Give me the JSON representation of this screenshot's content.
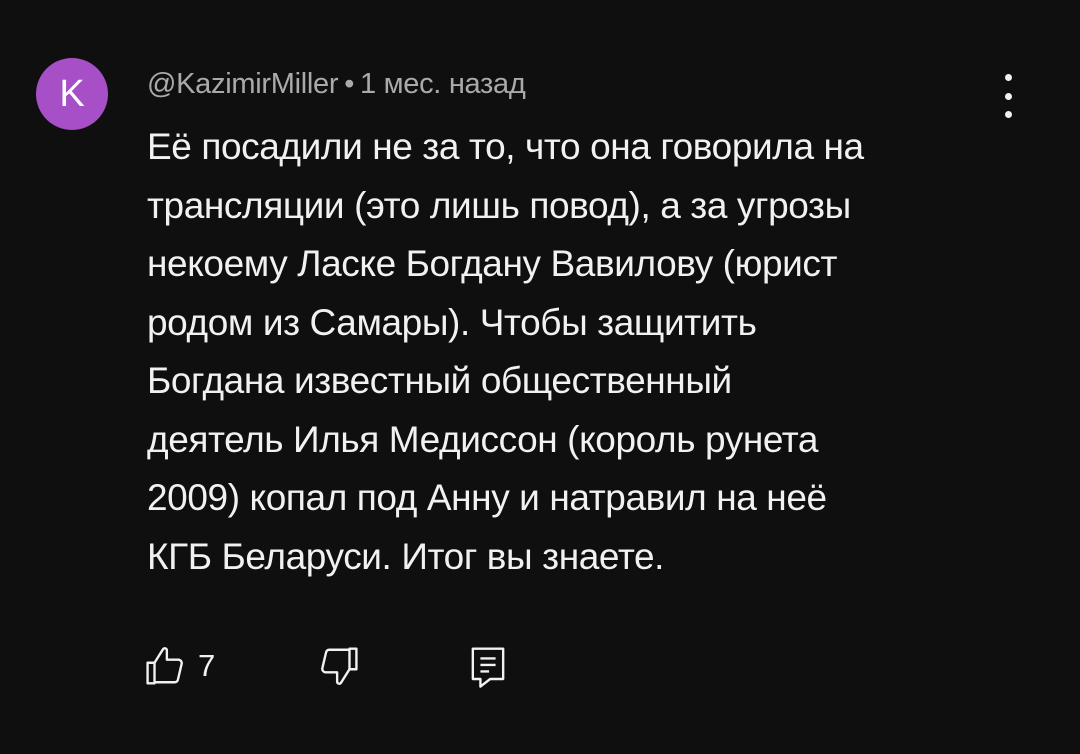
{
  "comment": {
    "avatar_letter": "K",
    "avatar_color": "#a64fc7",
    "author": "@KazimirMiller",
    "separator": "•",
    "time": "1 мес. назад",
    "lines": [
      "Её посадили не за то, что она говорила на",
      "трансляции (это лишь повод), а за угрозы",
      "некоему Ласке Богдану Вавилову (юрист",
      "родом из Самары). Чтобы защитить",
      "Богдана известный общественный",
      "деятель Илья Медиссон (король рунета",
      "2009) копал под Анну и натравил на неё",
      "КГБ Беларуси. Итог вы знаете."
    ],
    "like_count": "7",
    "icons": {
      "menu": "more-vertical-icon",
      "like": "thumb-up-icon",
      "dislike": "thumb-down-icon",
      "reply": "reply-comment-icon"
    }
  }
}
